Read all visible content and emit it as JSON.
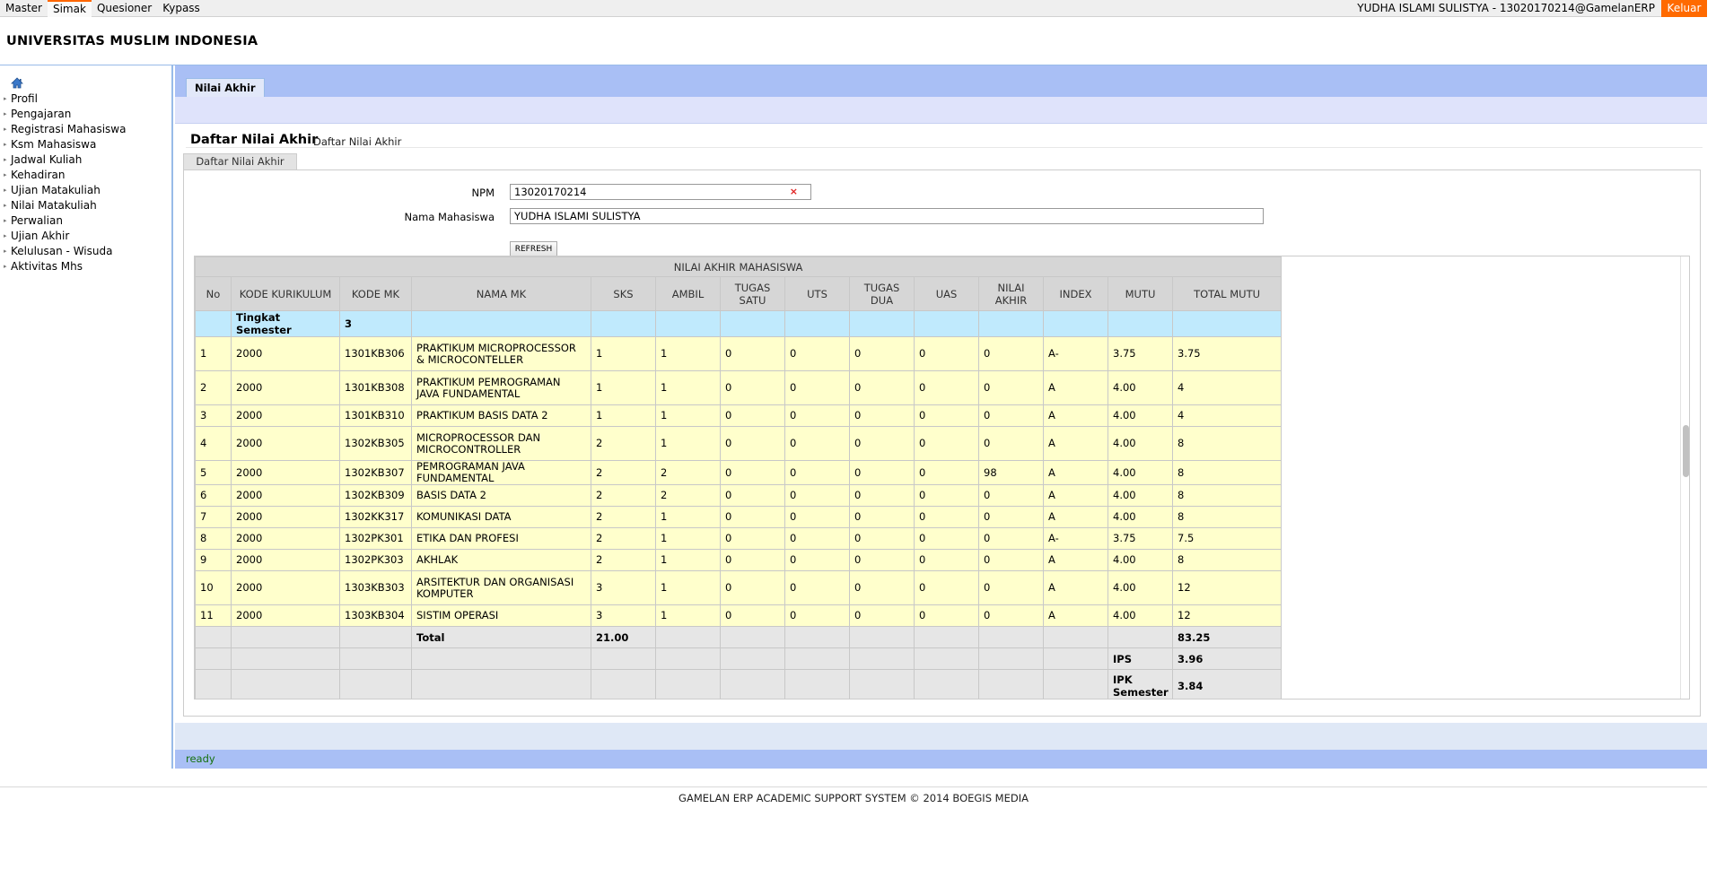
{
  "topnav": {
    "items": [
      "Master",
      "Simak",
      "Quesioner",
      "Kypass"
    ],
    "active_index": 1
  },
  "user": {
    "label": "YUDHA ISLAMI SULISTYA - 13020170214@GamelanERP",
    "logout": "Keluar"
  },
  "app": {
    "title": "UNIVERSITAS MUSLIM INDONESIA"
  },
  "sidebar": {
    "home_icon": "home-icon",
    "items": [
      "Profil",
      "Pengajaran",
      "Registrasi Mahasiswa",
      "Ksm Mahasiswa",
      "Jadwal Kuliah",
      "Kehadiran",
      "Ujian Matakuliah",
      "Nilai Matakuliah",
      "Perwalian",
      "Ujian Akhir",
      "Kelulusan - Wisuda",
      "Aktivitas Mhs"
    ]
  },
  "main": {
    "tab": "Nilai Akhir",
    "page_title": "Daftar Nilai Akhir",
    "breadcrumb": "Daftar Nilai Akhir"
  },
  "form": {
    "tab_label": "Daftar Nilai Akhir",
    "npm_label": "NPM",
    "npm_value": "13020170214",
    "nama_label": "Nama Mahasiswa",
    "nama_value": "YUDHA ISLAMI SULISTYA",
    "refresh": "REFRESH"
  },
  "grid": {
    "caption": "NILAI AKHIR MAHASISWA",
    "headers": [
      "No",
      "KODE KURIKULUM",
      "KODE MK",
      "NAMA MK",
      "SKS",
      "AMBIL",
      "TUGAS SATU",
      "UTS",
      "TUGAS DUA",
      "UAS",
      "NILAI AKHIR",
      "INDEX",
      "MUTU",
      "TOTAL MUTU"
    ],
    "semester": {
      "label": "Tingkat Semester",
      "value": "3"
    },
    "rows": [
      {
        "no": "1",
        "kurikulum": "2000",
        "kode": "1301KB306",
        "nama": "PRAKTIKUM MICROPROCESSOR & MICROCONTELLER",
        "sks": "1",
        "ambil": "1",
        "t1": "0",
        "uts": "0",
        "t2": "0",
        "uas": "0",
        "akhir": "0",
        "indeks": "A-",
        "mutu": "3.75",
        "total": "3.75",
        "tall": true
      },
      {
        "no": "2",
        "kurikulum": "2000",
        "kode": "1301KB308",
        "nama": "PRAKTIKUM PEMROGRAMAN JAVA FUNDAMENTAL",
        "sks": "1",
        "ambil": "1",
        "t1": "0",
        "uts": "0",
        "t2": "0",
        "uas": "0",
        "akhir": "0",
        "indeks": "A",
        "mutu": "4.00",
        "total": "4",
        "tall": true
      },
      {
        "no": "3",
        "kurikulum": "2000",
        "kode": "1301KB310",
        "nama": "PRAKTIKUM BASIS DATA 2",
        "sks": "1",
        "ambil": "1",
        "t1": "0",
        "uts": "0",
        "t2": "0",
        "uas": "0",
        "akhir": "0",
        "indeks": "A",
        "mutu": "4.00",
        "total": "4",
        "tall": false
      },
      {
        "no": "4",
        "kurikulum": "2000",
        "kode": "1302KB305",
        "nama": "MICROPROCESSOR DAN MICROCONTROLLER",
        "sks": "2",
        "ambil": "1",
        "t1": "0",
        "uts": "0",
        "t2": "0",
        "uas": "0",
        "akhir": "0",
        "indeks": "A",
        "mutu": "4.00",
        "total": "8",
        "tall": true
      },
      {
        "no": "5",
        "kurikulum": "2000",
        "kode": "1302KB307",
        "nama": "PEMROGRAMAN JAVA FUNDAMENTAL",
        "sks": "2",
        "ambil": "2",
        "t1": "0",
        "uts": "0",
        "t2": "0",
        "uas": "0",
        "akhir": "98",
        "indeks": "A",
        "mutu": "4.00",
        "total": "8",
        "tall": false
      },
      {
        "no": "6",
        "kurikulum": "2000",
        "kode": "1302KB309",
        "nama": "BASIS DATA 2",
        "sks": "2",
        "ambil": "2",
        "t1": "0",
        "uts": "0",
        "t2": "0",
        "uas": "0",
        "akhir": "0",
        "indeks": "A",
        "mutu": "4.00",
        "total": "8",
        "tall": false
      },
      {
        "no": "7",
        "kurikulum": "2000",
        "kode": "1302KK317",
        "nama": "KOMUNIKASI DATA",
        "sks": "2",
        "ambil": "1",
        "t1": "0",
        "uts": "0",
        "t2": "0",
        "uas": "0",
        "akhir": "0",
        "indeks": "A",
        "mutu": "4.00",
        "total": "8",
        "tall": false
      },
      {
        "no": "8",
        "kurikulum": "2000",
        "kode": "1302PK301",
        "nama": "ETIKA DAN PROFESI",
        "sks": "2",
        "ambil": "1",
        "t1": "0",
        "uts": "0",
        "t2": "0",
        "uas": "0",
        "akhir": "0",
        "indeks": "A-",
        "mutu": "3.75",
        "total": "7.5",
        "tall": false
      },
      {
        "no": "9",
        "kurikulum": "2000",
        "kode": "1302PK303",
        "nama": "AKHLAK",
        "sks": "2",
        "ambil": "1",
        "t1": "0",
        "uts": "0",
        "t2": "0",
        "uas": "0",
        "akhir": "0",
        "indeks": "A",
        "mutu": "4.00",
        "total": "8",
        "tall": false
      },
      {
        "no": "10",
        "kurikulum": "2000",
        "kode": "1303KB303",
        "nama": "ARSITEKTUR DAN ORGANISASI KOMPUTER",
        "sks": "3",
        "ambil": "1",
        "t1": "0",
        "uts": "0",
        "t2": "0",
        "uas": "0",
        "akhir": "0",
        "indeks": "A",
        "mutu": "4.00",
        "total": "12",
        "tall": true
      },
      {
        "no": "11",
        "kurikulum": "2000",
        "kode": "1303KB304",
        "nama": "SISTIM OPERASI",
        "sks": "3",
        "ambil": "1",
        "t1": "0",
        "uts": "0",
        "t2": "0",
        "uas": "0",
        "akhir": "0",
        "indeks": "A",
        "mutu": "4.00",
        "total": "12",
        "tall": false
      }
    ],
    "total": {
      "label": "Total",
      "sks": "21.00",
      "total_mutu": "83.25"
    },
    "ips": {
      "label": "IPS",
      "value": "3.96"
    },
    "ipk": {
      "label": "IPK Semester",
      "value": "3.84"
    }
  },
  "status": {
    "text": "ready"
  },
  "footer": {
    "text": "GAMELAN ERP ACADEMIC SUPPORT SYSTEM © 2014 BOEGIS MEDIA"
  }
}
